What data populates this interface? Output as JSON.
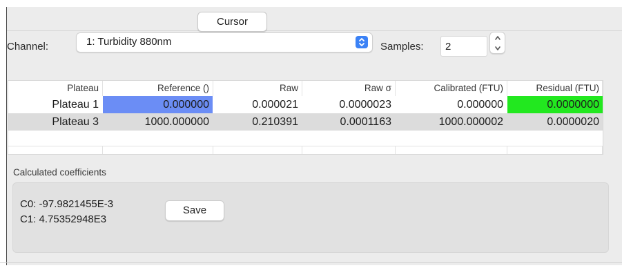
{
  "tab": {
    "label": "Cursor"
  },
  "channel": {
    "label": "Channel:",
    "selected": "1: Turbidity 880nm"
  },
  "samples": {
    "label": "Samples:",
    "value": "2"
  },
  "table": {
    "headers": [
      "Plateau",
      "Reference ()",
      "Raw",
      "Raw σ",
      "Calibrated (FTU)",
      "Residual (FTU)"
    ],
    "rows": [
      [
        "Plateau 1",
        "0.000000",
        "0.000021",
        "0.0000023",
        "0.000000",
        "0.0000000"
      ],
      [
        "Plateau 3",
        "1000.000000",
        "0.210391",
        "0.0001163",
        "1000.000002",
        "0.0000020"
      ]
    ]
  },
  "coefficients": {
    "label": "Calculated coefficients",
    "c0": "C0: -97.9821455E-3",
    "c1": "C1: 4.75352948E3",
    "save_label": "Save"
  },
  "colors": {
    "accent": "#3b82f6",
    "reference_highlight": "#6b8df5",
    "residual_highlight": "#22e81f"
  },
  "icons": {
    "select_arrow": "chevron-updown-icon",
    "stepper_up": "chevron-up-icon",
    "stepper_down": "chevron-down-icon"
  }
}
